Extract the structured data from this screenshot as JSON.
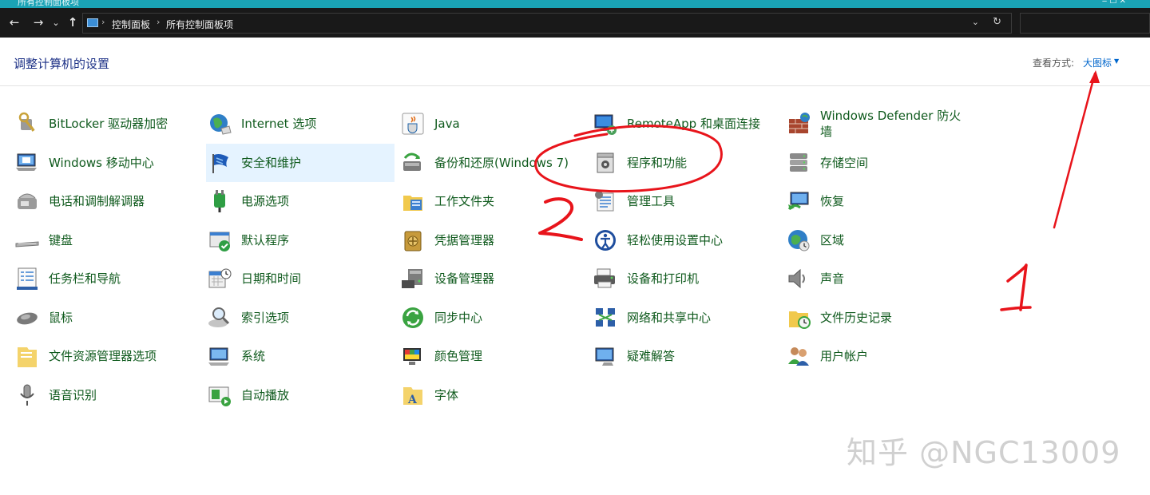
{
  "window": {
    "title": "所有控制面板项"
  },
  "nav": {
    "back": "←",
    "forward": "→",
    "recent": "⌄",
    "up": "↑"
  },
  "address": {
    "crumbs": [
      "控制面板",
      "所有控制面板项"
    ],
    "dropdown": "⌄",
    "refresh": "↻"
  },
  "header": {
    "title": "调整计算机的设置",
    "view_by_label": "查看方式:",
    "view_by_value": "大图标"
  },
  "items": [
    {
      "label": "BitLocker 驱动器加密",
      "icon": "bitlocker-key-icon"
    },
    {
      "label": "Internet 选项",
      "icon": "globe-icon"
    },
    {
      "label": "Java",
      "icon": "java-cup-icon"
    },
    {
      "label": "RemoteApp 和桌面连接",
      "icon": "remote-desktop-icon"
    },
    {
      "label": "Windows Defender 防火墙",
      "icon": "firewall-icon"
    },
    {
      "label": "Windows 移动中心",
      "icon": "mobility-center-icon"
    },
    {
      "label": "安全和维护",
      "icon": "security-flag-icon"
    },
    {
      "label": "备份和还原(Windows 7)",
      "icon": "backup-icon"
    },
    {
      "label": "程序和功能",
      "icon": "programs-box-icon"
    },
    {
      "label": "存储空间",
      "icon": "storage-drives-icon"
    },
    {
      "label": "电话和调制解调器",
      "icon": "phone-modem-icon"
    },
    {
      "label": "电源选项",
      "icon": "power-plug-icon"
    },
    {
      "label": "工作文件夹",
      "icon": "work-folder-icon"
    },
    {
      "label": "管理工具",
      "icon": "admin-tools-icon"
    },
    {
      "label": "恢复",
      "icon": "recovery-icon"
    },
    {
      "label": "键盘",
      "icon": "keyboard-icon"
    },
    {
      "label": "默认程序",
      "icon": "default-programs-icon"
    },
    {
      "label": "凭据管理器",
      "icon": "credential-vault-icon"
    },
    {
      "label": "轻松使用设置中心",
      "icon": "ease-of-access-icon"
    },
    {
      "label": "区域",
      "icon": "region-globe-icon"
    },
    {
      "label": "任务栏和导航",
      "icon": "taskbar-icon"
    },
    {
      "label": "日期和时间",
      "icon": "calendar-clock-icon"
    },
    {
      "label": "设备管理器",
      "icon": "device-manager-icon"
    },
    {
      "label": "设备和打印机",
      "icon": "printer-icon"
    },
    {
      "label": "声音",
      "icon": "speaker-icon"
    },
    {
      "label": "鼠标",
      "icon": "mouse-icon"
    },
    {
      "label": "索引选项",
      "icon": "index-magnifier-icon"
    },
    {
      "label": "同步中心",
      "icon": "sync-center-icon"
    },
    {
      "label": "网络和共享中心",
      "icon": "network-icon"
    },
    {
      "label": "文件历史记录",
      "icon": "file-history-icon"
    },
    {
      "label": "文件资源管理器选项",
      "icon": "folder-options-icon"
    },
    {
      "label": "系统",
      "icon": "system-monitor-icon"
    },
    {
      "label": "颜色管理",
      "icon": "color-management-icon"
    },
    {
      "label": "疑难解答",
      "icon": "troubleshoot-icon"
    },
    {
      "label": "用户帐户",
      "icon": "user-accounts-icon"
    },
    {
      "label": "语音识别",
      "icon": "microphone-icon"
    },
    {
      "label": "自动播放",
      "icon": "autoplay-icon"
    },
    {
      "label": "字体",
      "icon": "fonts-icon"
    }
  ],
  "annotations": {
    "mark_1": "1",
    "mark_2": "2"
  },
  "watermark": "知乎 @NGC13009",
  "colors": {
    "link_green": "#0f5a1d",
    "title_blue": "#1e3287",
    "accent_blue": "#0066cc",
    "annotation_red": "#e8141b",
    "selection": "#e5f3ff"
  }
}
